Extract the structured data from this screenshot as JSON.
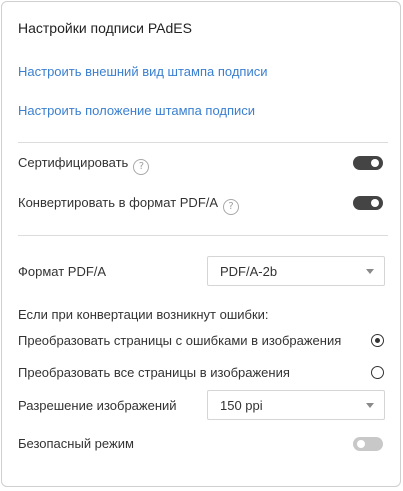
{
  "panel": {
    "title": "Настройки подписи PAdES",
    "links": {
      "appearance": "Настроить внешний вид штампа подписи",
      "position": "Настроить положение штампа подписи"
    },
    "certify": {
      "label": "Сертифицировать",
      "help_icon": "help-icon",
      "enabled": true
    },
    "convert_pdfa": {
      "label": "Конвертировать в формат PDF/A",
      "help_icon": "help-icon",
      "enabled": true
    },
    "pdfa_format": {
      "label": "Формат PDF/A",
      "selected": "PDF/A-2b"
    },
    "errors": {
      "heading": "Если при конвертации возникнут ошибки:",
      "options": [
        {
          "label": "Преобразовать страницы с ошибками в изображения",
          "selected": true
        },
        {
          "label": "Преобразовать все страницы в изображения",
          "selected": false
        }
      ]
    },
    "image_resolution": {
      "label": "Разрешение изображений",
      "selected": "150 ppi"
    },
    "safe_mode": {
      "label": "Безопасный режим",
      "enabled": false
    }
  },
  "colors": {
    "link": "#3a7fd0",
    "toggle_on": "#444444",
    "toggle_off": "#c8c8c8",
    "divider": "#dcdcdc"
  }
}
